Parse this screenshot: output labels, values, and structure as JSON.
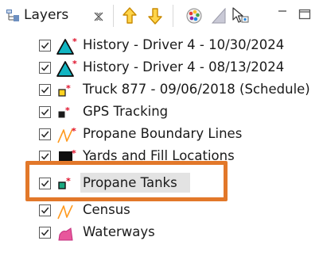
{
  "tab": {
    "label": "Layers"
  },
  "layers": [
    {
      "label": "History - Driver 4 - 10/30/2024",
      "checked": true,
      "icon": "history-triangle-icon"
    },
    {
      "label": "History - Driver 4 - 08/13/2024",
      "checked": true,
      "icon": "history-triangle-icon"
    },
    {
      "label": "Truck 877 - 09/06/2018 (Schedule)",
      "checked": true,
      "icon": "truck-point-icon"
    },
    {
      "label": "GPS Tracking",
      "checked": true,
      "icon": "gps-point-icon"
    },
    {
      "label": "Propane Boundary Lines",
      "checked": true,
      "icon": "line-layer-icon"
    },
    {
      "label": "Yards and Fill Locations",
      "checked": true,
      "icon": "raster-layer-icon"
    },
    {
      "label": "Propane Tanks",
      "checked": true,
      "icon": "tank-point-icon",
      "selected": true
    },
    {
      "label": "Census",
      "checked": true,
      "icon": "line-layer-icon"
    },
    {
      "label": "Waterways",
      "checked": true,
      "icon": "polygon-layer-icon"
    }
  ],
  "colors": {
    "highlight": "#e2782a",
    "selection": "#e3e3e3",
    "accent_red": "#e0102a",
    "arrow_yellow": "#f0b800"
  }
}
